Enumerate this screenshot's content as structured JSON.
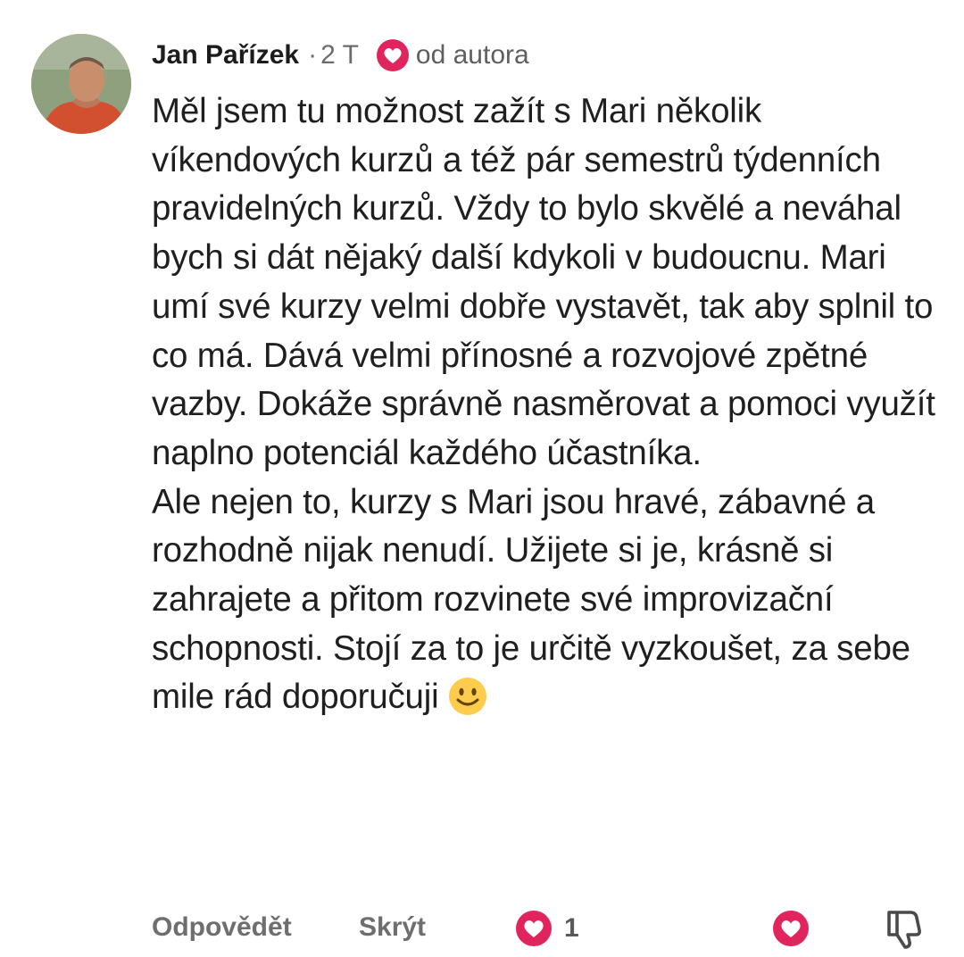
{
  "comment": {
    "author": "Jan Pařízek",
    "separator": "·",
    "time": "2 T",
    "author_heart_label": "od autora",
    "paragraphs": [
      "Měl jsem tu možnost zažít s Mari několik víkendových kurzů a též pár semestrů týdenních pravidelných kurzů. Vždy to bylo skvělé a neváhal bych si dát nějaký další kdykoli v budoucnu. Mari umí své kurzy velmi dobře vystavět, tak aby splnil to co má. Dává velmi přínosné a rozvojové zpětné vazby. Dokáže správně nasměrovat a pomoci využít naplno potenciál každého účastníka.",
      "Ale nejen to, kurzy s Mari jsou hravé, zábavné a rozhodně nijak nenudí. Užijete si je, krásně si zahrajete a přitom rozvinete své improvizační schopnosti. Stojí za to je určitě vyzkoušet, za sebe mile rád doporučuji"
    ],
    "emoji": "slightly-smiling-face",
    "actions": {
      "reply_label": "Odpovědět",
      "hide_label": "Skrýt",
      "like_count": "1"
    }
  },
  "icons": {
    "heart": "heart-icon",
    "dislike": "thumbs-down-icon"
  },
  "colors": {
    "heart_red": "#e0245e",
    "text": "#1f1f1f",
    "muted": "#6e6e6e"
  }
}
